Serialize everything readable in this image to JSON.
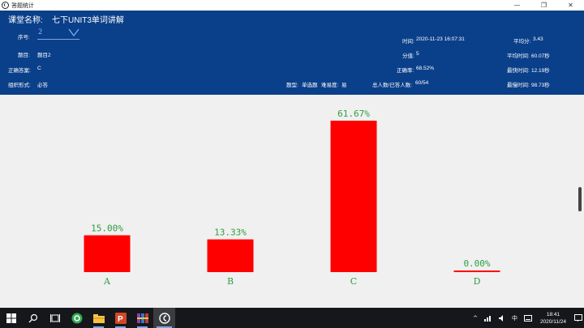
{
  "window": {
    "title": "答题统计",
    "controls": {
      "minimize": "—",
      "restore": "❐",
      "close": "✕"
    }
  },
  "header": {
    "course_label": "课堂名称:",
    "course_name": "七下UNIT3单词讲解",
    "seq_label": "序号:",
    "seq_value": "2",
    "question_label": "题目:",
    "question_value": "题目2",
    "answer_label": "正确答案:",
    "answer_value": "C",
    "mode_label": "组织形式:",
    "mode_value": "必答",
    "time_label": "时间:",
    "time_value": "2020-11-23 16:07:31",
    "score_label": "分值:",
    "score_value": "5",
    "rate_label": "正确率:",
    "rate_value": "68.52%",
    "qtype_label": "题型:",
    "qtype_value": "单选题",
    "difficulty_label": "难易度:",
    "difficulty_value": "易",
    "total_label": "总人数/已答人数:",
    "total_value": "60/54",
    "avg_score_label": "平均分:",
    "avg_score_value": "3.43",
    "avg_time_label": "平均时间:",
    "avg_time_value": "60.07秒",
    "fastest_label": "最快时间:",
    "fastest_value": "12.19秒",
    "slowest_label": "最慢时间:",
    "slowest_value": "98.73秒"
  },
  "chart_data": {
    "type": "bar",
    "categories": [
      "A",
      "B",
      "C",
      "D"
    ],
    "values": [
      15.0,
      13.33,
      61.67,
      0.0
    ],
    "labels": [
      "15.00%",
      "13.33%",
      "61.67%",
      "0.00%"
    ],
    "ylim": [
      0,
      61.67
    ],
    "bar_color": "#ff0000",
    "label_color": "#2e9e3e",
    "grid": false
  },
  "taskbar": {
    "apps": [
      "windows-logo-icon",
      "search-icon",
      "task-view-icon",
      "green-app-icon",
      "file-explorer-icon",
      "powerpoint-icon",
      "winrar-icon",
      "answer-stats-icon"
    ],
    "tray": {
      "chevron": "^",
      "ime": "中",
      "time": "18:41",
      "date": "2020/11/24"
    }
  }
}
